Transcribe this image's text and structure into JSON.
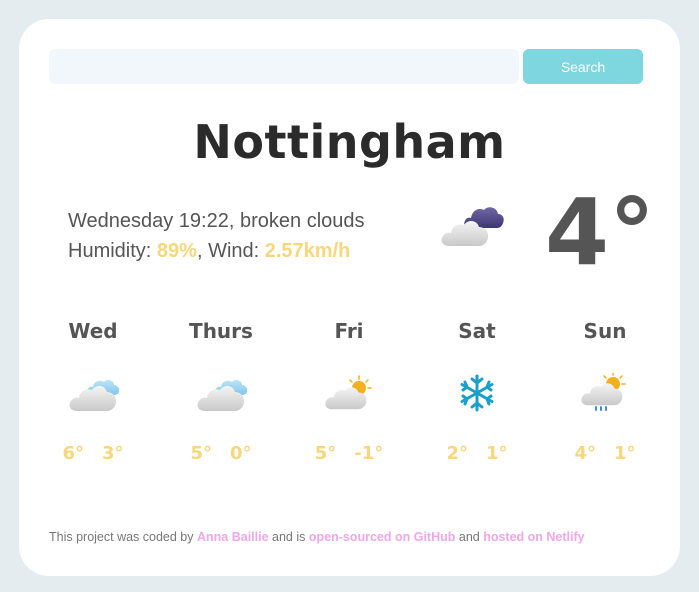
{
  "search": {
    "value": "",
    "placeholder": "",
    "button_label": "Search"
  },
  "current": {
    "city": "Nottingham",
    "day_time": "Wednesday 19:22",
    "description": "broken clouds",
    "humidity_label": "Humidity: ",
    "humidity": "89%",
    "wind_label": "Wind: ",
    "wind": "2.57km/h",
    "temperature": "4°",
    "icon": "broken-clouds-icon"
  },
  "forecast": [
    {
      "day": "Wed",
      "max": "6°",
      "min": "3°",
      "icon": "cloud-icon"
    },
    {
      "day": "Thurs",
      "max": "5°",
      "min": "0°",
      "icon": "cloud-icon"
    },
    {
      "day": "Fri",
      "max": "5°",
      "min": "-1°",
      "icon": "sun-cloud-icon"
    },
    {
      "day": "Sat",
      "max": "2°",
      "min": "1°",
      "icon": "snowflake-icon"
    },
    {
      "day": "Sun",
      "max": "4°",
      "min": "1°",
      "icon": "sun-rain-cloud-icon"
    }
  ],
  "footer": {
    "text_1": "This project was coded by ",
    "author": "Anna Baillie",
    "text_2": " and is ",
    "github_link": "open-sourced on GitHub",
    "text_3": " and ",
    "netlify_link": "hosted on Netlify"
  },
  "colors": {
    "accent": "#f7d77a",
    "button": "#7ed6df",
    "link": "#f0a6e8"
  }
}
